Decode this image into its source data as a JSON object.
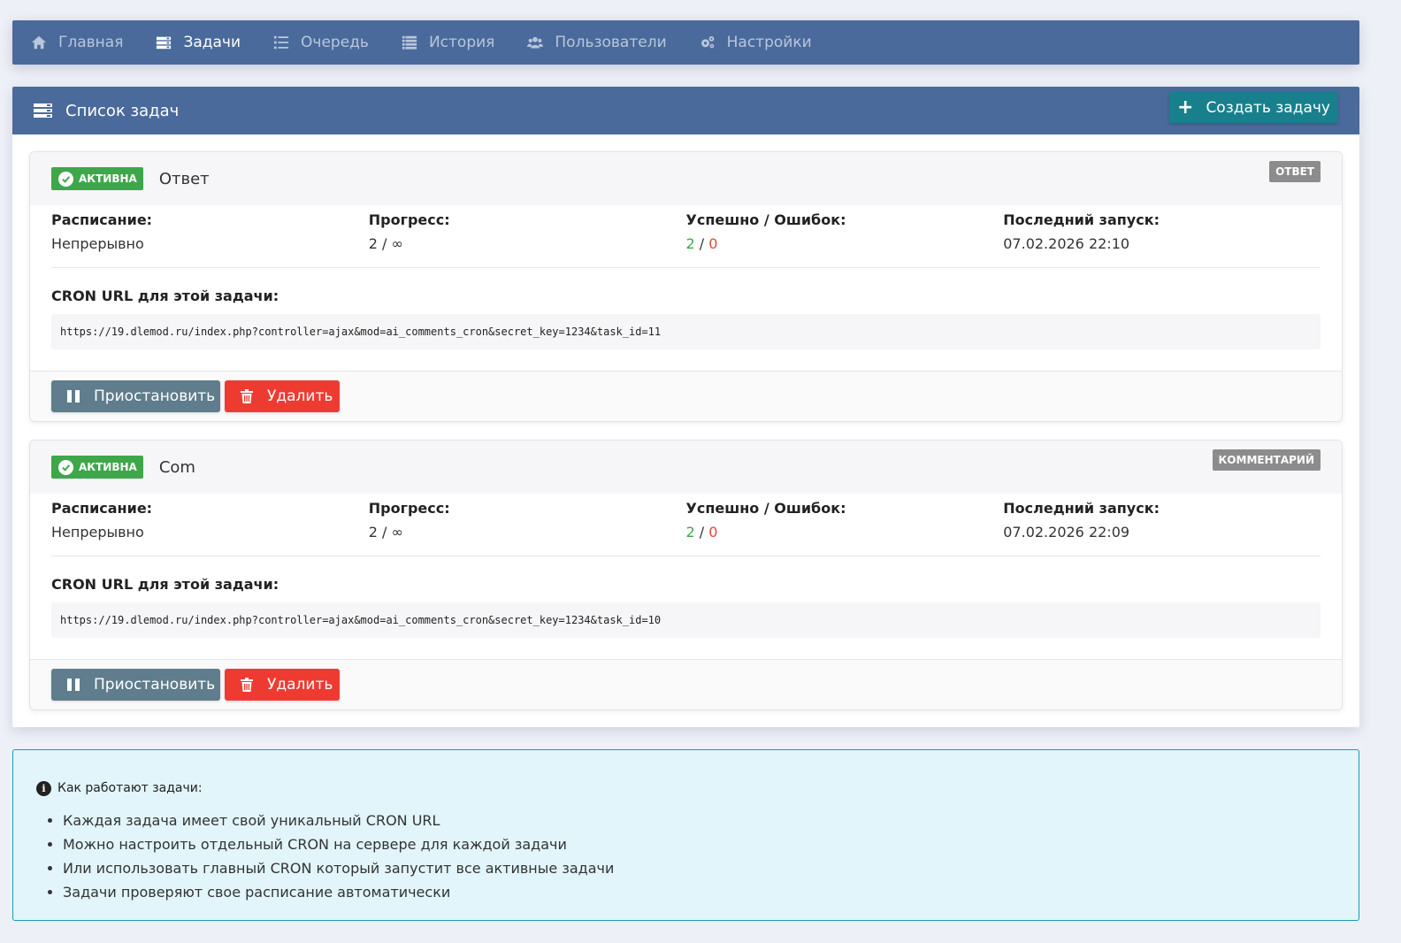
{
  "nav": {
    "items": [
      {
        "label": "Главная",
        "icon": "home-icon"
      },
      {
        "label": "Задачи",
        "icon": "tasks-list-icon",
        "active": true
      },
      {
        "label": "Очередь",
        "icon": "queue-list-icon"
      },
      {
        "label": "История",
        "icon": "history-list-icon"
      },
      {
        "label": "Пользователи",
        "icon": "users-icon"
      },
      {
        "label": "Настройки",
        "icon": "settings-gears-icon"
      }
    ]
  },
  "panel": {
    "title": "Список задач",
    "create_label": "Создать задачу"
  },
  "labels": {
    "schedule": "Расписание:",
    "progress": "Прогресс:",
    "success_errors": "Успешно / Ошибок:",
    "last_run": "Последний запуск:",
    "cron_url": "CRON URL для этой задачи:",
    "pause": "Приостановить",
    "delete": "Удалить",
    "separator": "/"
  },
  "tasks": [
    {
      "status": "АКТИВНА",
      "name": "Ответ",
      "type": "ОТВЕТ",
      "schedule": "Непрерывно",
      "progress": "2 / ∞",
      "success": "2",
      "errors": "0",
      "last_run": "07.02.2026 22:10",
      "cron_url": "https://19.dlemod.ru/index.php?controller=ajax&mod=ai_comments_cron&secret_key=1234&task_id=11"
    },
    {
      "status": "АКТИВНА",
      "name": "Com",
      "type": "КОММЕНТАРИЙ",
      "schedule": "Непрерывно",
      "progress": "2 / ∞",
      "success": "2",
      "errors": "0",
      "last_run": "07.02.2026 22:09",
      "cron_url": "https://19.dlemod.ru/index.php?controller=ajax&mod=ai_comments_cron&secret_key=1234&task_id=10"
    }
  ],
  "info": {
    "title": "Как работают задачи:",
    "items": [
      "Каждая задача имеет свой уникальный CRON URL",
      "Можно настроить отдельный CRON на сервере для каждой задачи",
      "Или использовать главный CRON который запустит все активные задачи",
      "Задачи проверяют свое расписание автоматически"
    ]
  },
  "colors": {
    "nav_bg": "#4a6a9b",
    "create_button": "#17808c",
    "active_badge": "#3ea74a",
    "type_badge": "#8c8c8c",
    "pause_button": "#5f7d8c",
    "delete_button": "#ee3b32",
    "info_bg": "#e1f5fb",
    "info_border": "#1b9aaf"
  }
}
